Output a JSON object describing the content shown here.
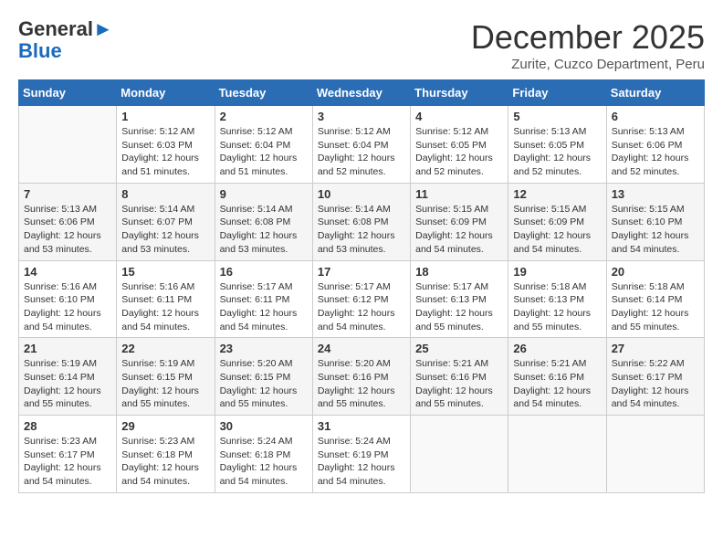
{
  "logo": {
    "general": "General",
    "blue": "Blue"
  },
  "header": {
    "month": "December 2025",
    "location": "Zurite, Cuzco Department, Peru"
  },
  "days_of_week": [
    "Sunday",
    "Monday",
    "Tuesday",
    "Wednesday",
    "Thursday",
    "Friday",
    "Saturday"
  ],
  "weeks": [
    [
      {
        "day": "",
        "sunrise": "",
        "sunset": "",
        "daylight": ""
      },
      {
        "day": "1",
        "sunrise": "Sunrise: 5:12 AM",
        "sunset": "Sunset: 6:03 PM",
        "daylight": "Daylight: 12 hours and 51 minutes."
      },
      {
        "day": "2",
        "sunrise": "Sunrise: 5:12 AM",
        "sunset": "Sunset: 6:04 PM",
        "daylight": "Daylight: 12 hours and 51 minutes."
      },
      {
        "day": "3",
        "sunrise": "Sunrise: 5:12 AM",
        "sunset": "Sunset: 6:04 PM",
        "daylight": "Daylight: 12 hours and 52 minutes."
      },
      {
        "day": "4",
        "sunrise": "Sunrise: 5:12 AM",
        "sunset": "Sunset: 6:05 PM",
        "daylight": "Daylight: 12 hours and 52 minutes."
      },
      {
        "day": "5",
        "sunrise": "Sunrise: 5:13 AM",
        "sunset": "Sunset: 6:05 PM",
        "daylight": "Daylight: 12 hours and 52 minutes."
      },
      {
        "day": "6",
        "sunrise": "Sunrise: 5:13 AM",
        "sunset": "Sunset: 6:06 PM",
        "daylight": "Daylight: 12 hours and 52 minutes."
      }
    ],
    [
      {
        "day": "7",
        "sunrise": "Sunrise: 5:13 AM",
        "sunset": "Sunset: 6:06 PM",
        "daylight": "Daylight: 12 hours and 53 minutes."
      },
      {
        "day": "8",
        "sunrise": "Sunrise: 5:14 AM",
        "sunset": "Sunset: 6:07 PM",
        "daylight": "Daylight: 12 hours and 53 minutes."
      },
      {
        "day": "9",
        "sunrise": "Sunrise: 5:14 AM",
        "sunset": "Sunset: 6:08 PM",
        "daylight": "Daylight: 12 hours and 53 minutes."
      },
      {
        "day": "10",
        "sunrise": "Sunrise: 5:14 AM",
        "sunset": "Sunset: 6:08 PM",
        "daylight": "Daylight: 12 hours and 53 minutes."
      },
      {
        "day": "11",
        "sunrise": "Sunrise: 5:15 AM",
        "sunset": "Sunset: 6:09 PM",
        "daylight": "Daylight: 12 hours and 54 minutes."
      },
      {
        "day": "12",
        "sunrise": "Sunrise: 5:15 AM",
        "sunset": "Sunset: 6:09 PM",
        "daylight": "Daylight: 12 hours and 54 minutes."
      },
      {
        "day": "13",
        "sunrise": "Sunrise: 5:15 AM",
        "sunset": "Sunset: 6:10 PM",
        "daylight": "Daylight: 12 hours and 54 minutes."
      }
    ],
    [
      {
        "day": "14",
        "sunrise": "Sunrise: 5:16 AM",
        "sunset": "Sunset: 6:10 PM",
        "daylight": "Daylight: 12 hours and 54 minutes."
      },
      {
        "day": "15",
        "sunrise": "Sunrise: 5:16 AM",
        "sunset": "Sunset: 6:11 PM",
        "daylight": "Daylight: 12 hours and 54 minutes."
      },
      {
        "day": "16",
        "sunrise": "Sunrise: 5:17 AM",
        "sunset": "Sunset: 6:11 PM",
        "daylight": "Daylight: 12 hours and 54 minutes."
      },
      {
        "day": "17",
        "sunrise": "Sunrise: 5:17 AM",
        "sunset": "Sunset: 6:12 PM",
        "daylight": "Daylight: 12 hours and 54 minutes."
      },
      {
        "day": "18",
        "sunrise": "Sunrise: 5:17 AM",
        "sunset": "Sunset: 6:13 PM",
        "daylight": "Daylight: 12 hours and 55 minutes."
      },
      {
        "day": "19",
        "sunrise": "Sunrise: 5:18 AM",
        "sunset": "Sunset: 6:13 PM",
        "daylight": "Daylight: 12 hours and 55 minutes."
      },
      {
        "day": "20",
        "sunrise": "Sunrise: 5:18 AM",
        "sunset": "Sunset: 6:14 PM",
        "daylight": "Daylight: 12 hours and 55 minutes."
      }
    ],
    [
      {
        "day": "21",
        "sunrise": "Sunrise: 5:19 AM",
        "sunset": "Sunset: 6:14 PM",
        "daylight": "Daylight: 12 hours and 55 minutes."
      },
      {
        "day": "22",
        "sunrise": "Sunrise: 5:19 AM",
        "sunset": "Sunset: 6:15 PM",
        "daylight": "Daylight: 12 hours and 55 minutes."
      },
      {
        "day": "23",
        "sunrise": "Sunrise: 5:20 AM",
        "sunset": "Sunset: 6:15 PM",
        "daylight": "Daylight: 12 hours and 55 minutes."
      },
      {
        "day": "24",
        "sunrise": "Sunrise: 5:20 AM",
        "sunset": "Sunset: 6:16 PM",
        "daylight": "Daylight: 12 hours and 55 minutes."
      },
      {
        "day": "25",
        "sunrise": "Sunrise: 5:21 AM",
        "sunset": "Sunset: 6:16 PM",
        "daylight": "Daylight: 12 hours and 55 minutes."
      },
      {
        "day": "26",
        "sunrise": "Sunrise: 5:21 AM",
        "sunset": "Sunset: 6:16 PM",
        "daylight": "Daylight: 12 hours and 54 minutes."
      },
      {
        "day": "27",
        "sunrise": "Sunrise: 5:22 AM",
        "sunset": "Sunset: 6:17 PM",
        "daylight": "Daylight: 12 hours and 54 minutes."
      }
    ],
    [
      {
        "day": "28",
        "sunrise": "Sunrise: 5:23 AM",
        "sunset": "Sunset: 6:17 PM",
        "daylight": "Daylight: 12 hours and 54 minutes."
      },
      {
        "day": "29",
        "sunrise": "Sunrise: 5:23 AM",
        "sunset": "Sunset: 6:18 PM",
        "daylight": "Daylight: 12 hours and 54 minutes."
      },
      {
        "day": "30",
        "sunrise": "Sunrise: 5:24 AM",
        "sunset": "Sunset: 6:18 PM",
        "daylight": "Daylight: 12 hours and 54 minutes."
      },
      {
        "day": "31",
        "sunrise": "Sunrise: 5:24 AM",
        "sunset": "Sunset: 6:19 PM",
        "daylight": "Daylight: 12 hours and 54 minutes."
      },
      {
        "day": "",
        "sunrise": "",
        "sunset": "",
        "daylight": ""
      },
      {
        "day": "",
        "sunrise": "",
        "sunset": "",
        "daylight": ""
      },
      {
        "day": "",
        "sunrise": "",
        "sunset": "",
        "daylight": ""
      }
    ]
  ]
}
